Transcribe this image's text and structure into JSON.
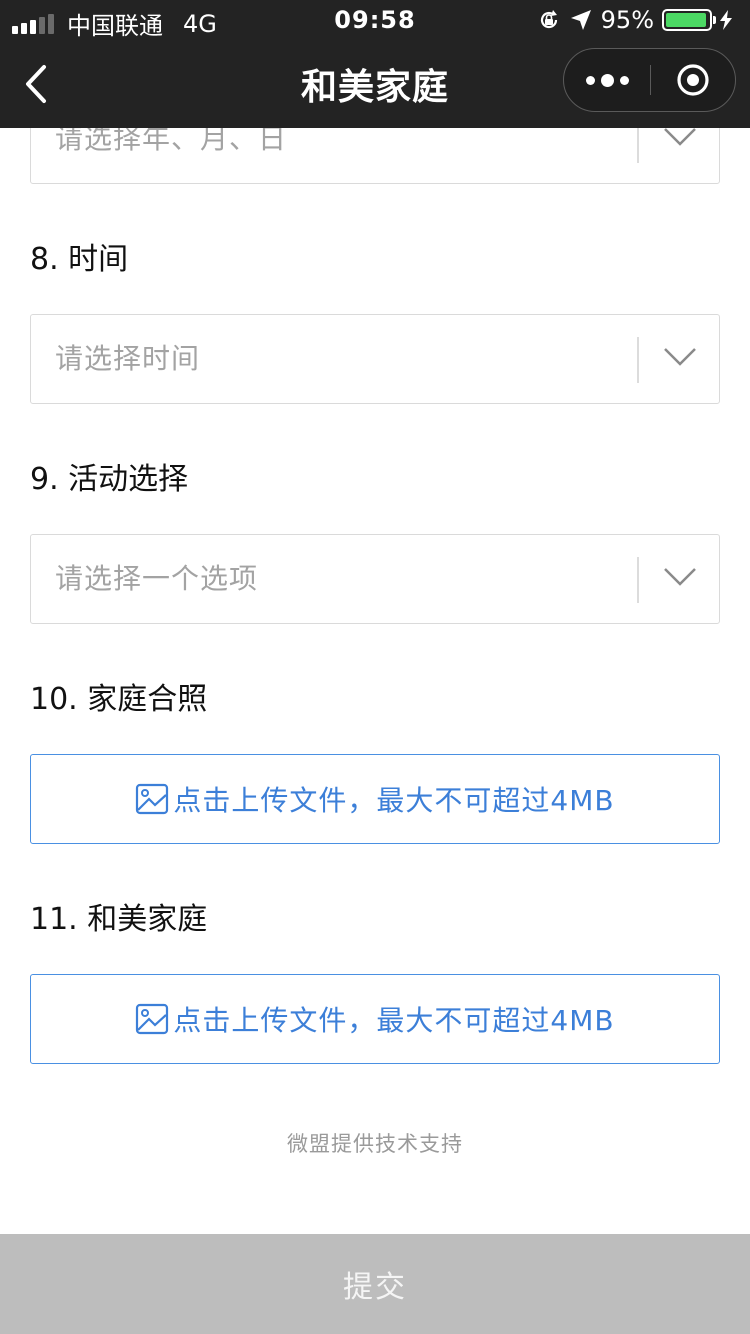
{
  "status_bar": {
    "carrier": "中国联通",
    "network": "4G",
    "time": "09:58",
    "battery_percent": "95%",
    "battery_level": 0.95,
    "battery_color": "#4cd964"
  },
  "nav": {
    "title": "和美家庭",
    "back_icon": "chevron-left-icon",
    "more_icon": "more-dots-icon",
    "close_icon": "target-circle-icon"
  },
  "form": {
    "date_field": {
      "placeholder": "请选择年、月、日"
    },
    "q8": {
      "label": "8. 时间",
      "placeholder": "请选择时间"
    },
    "q9": {
      "label": "9. 活动选择",
      "placeholder": "请选择一个选项"
    },
    "q10": {
      "label": "10. 家庭合照",
      "upload_text": "点击上传文件，最大不可超过4MB"
    },
    "q11": {
      "label": "11. 和美家庭",
      "upload_text": "点击上传文件，最大不可超过4MB"
    }
  },
  "footer": {
    "note": "微盟提供技术支持"
  },
  "submit": {
    "label": "提交"
  },
  "colors": {
    "accent": "#4a90e2",
    "topbar": "#232323",
    "submit_bg": "#bdbdbd"
  }
}
